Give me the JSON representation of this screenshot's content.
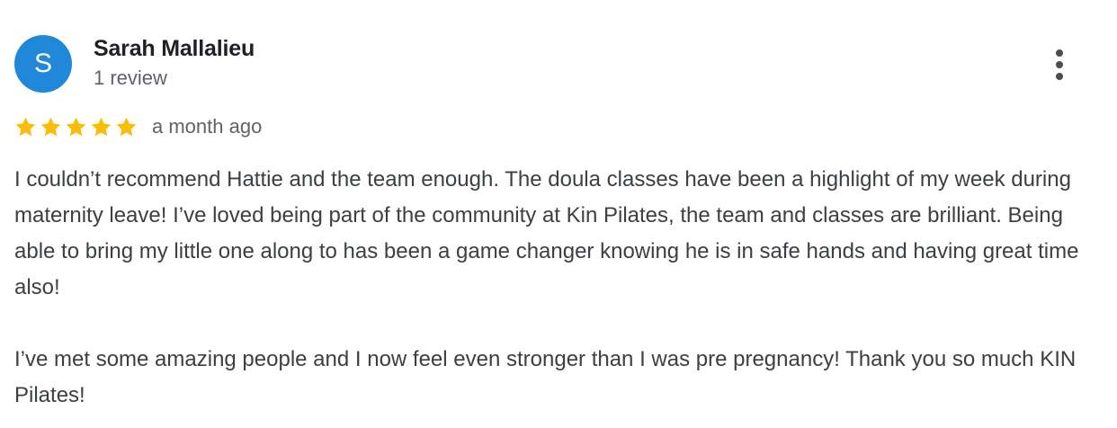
{
  "reviewer": {
    "initial": "S",
    "name": "Sarah Mallalieu",
    "review_count": "1 review",
    "avatar_color": "#1f88d8"
  },
  "menu": {
    "icon": "more-vert-icon"
  },
  "rating": {
    "stars": 5,
    "max_stars": 5,
    "star_color": "#fbbc04",
    "time_ago": "a month ago"
  },
  "review": {
    "paragraphs": [
      "I couldn’t recommend Hattie and the team enough. The doula classes have been a highlight of my week during maternity leave! I’ve loved being part of the community at Kin Pilates, the team and classes are brilliant. Being able to bring my little one along to has been a game changer knowing he is in safe hands and having great time also!",
      "I’ve met some amazing people and I now feel even stronger than I was pre pregnancy! Thank you so much KIN Pilates!"
    ]
  }
}
